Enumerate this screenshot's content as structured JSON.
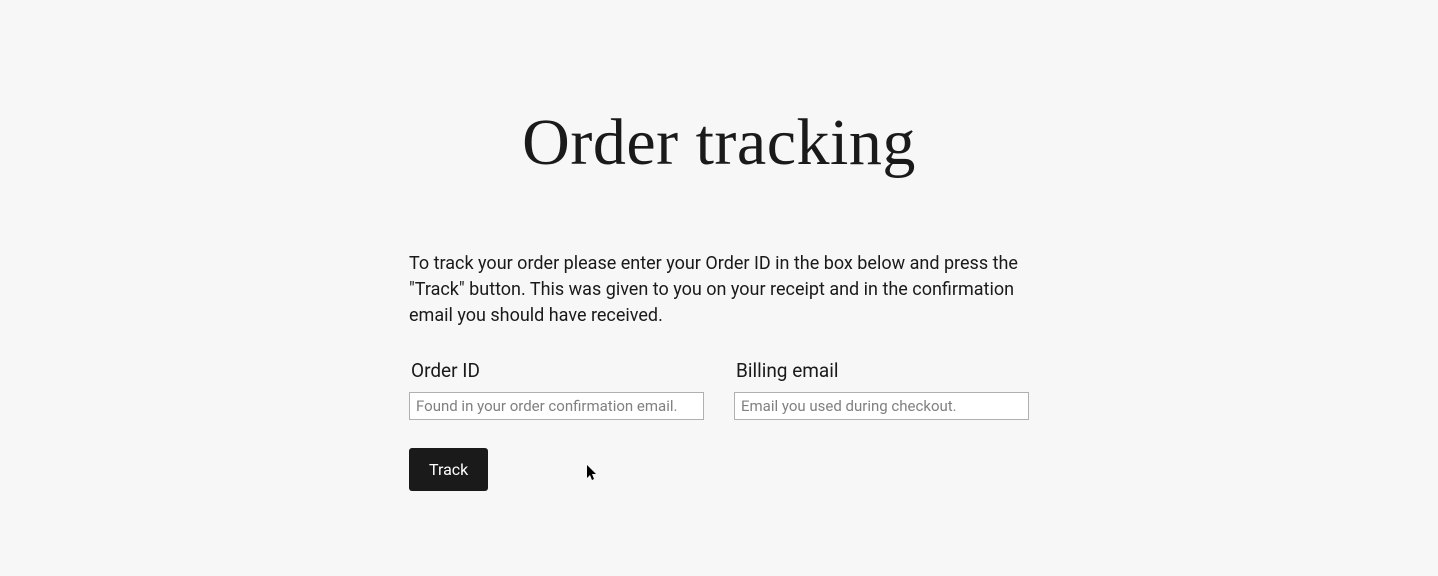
{
  "page": {
    "title": "Order tracking",
    "description": "To track your order please enter your Order ID in the box below and press the \"Track\" button. This was given to you on your receipt and in the confirmation email you should have received."
  },
  "form": {
    "order_id": {
      "label": "Order ID",
      "placeholder": "Found in your order confirmation email.",
      "value": ""
    },
    "billing_email": {
      "label": "Billing email",
      "placeholder": "Email you used during checkout.",
      "value": ""
    },
    "submit_label": "Track"
  }
}
